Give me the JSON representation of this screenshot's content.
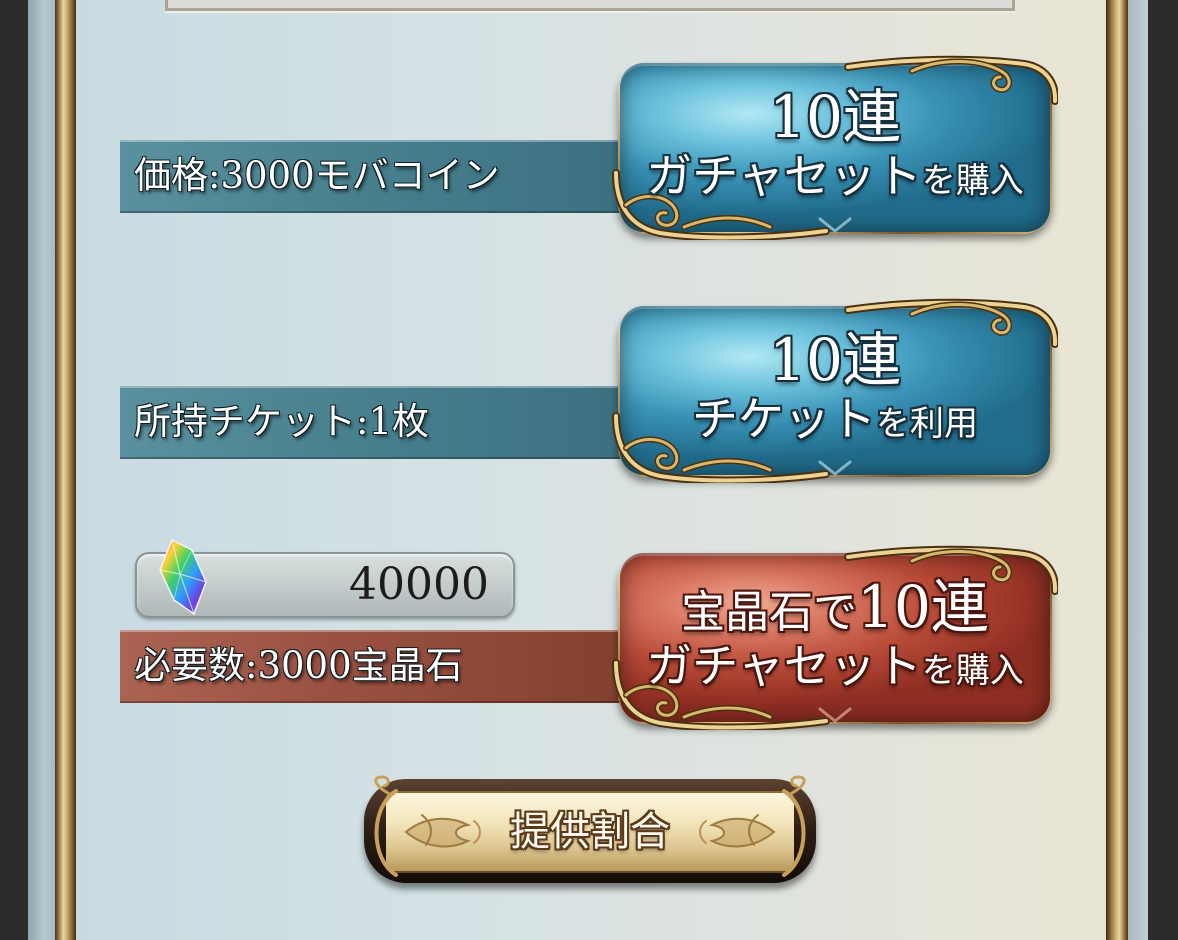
{
  "rows": {
    "coin": {
      "label": "価格:3000モバコイン",
      "button_line1": "10連",
      "button_line2": "ガチャセット",
      "button_line2_suffix": "を購入"
    },
    "ticket": {
      "label": "所持チケット:1枚",
      "button_line1": "10連",
      "button_line2": "チケット",
      "button_line2_suffix": "を利用"
    },
    "crystal": {
      "label": "必要数:3000宝晶石",
      "button_line1_prefix": "宝晶石で",
      "button_line1": "10連",
      "button_line2": "ガチャセット",
      "button_line2_suffix": "を購入"
    }
  },
  "crystal_balance": {
    "icon": "crystal-icon",
    "value": "40000"
  },
  "rates_button": {
    "label": "提供割合"
  },
  "colors": {
    "teal_bar": "#4a8290",
    "red_bar": "#9c5242",
    "blue_button": "#3a93b6",
    "red_button": "#b84a38",
    "gold_trim": "#d9bb7a"
  }
}
